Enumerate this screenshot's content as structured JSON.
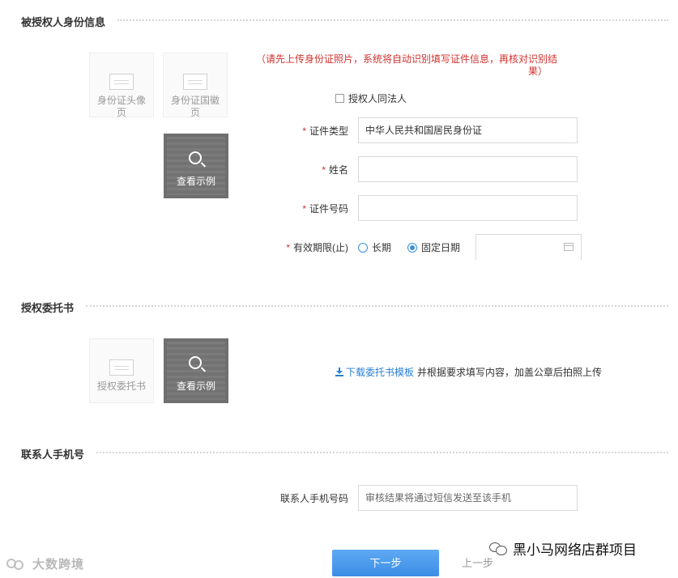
{
  "sections": {
    "authorized_person": "被授权人身份信息",
    "authorization_letter": "授权委托书",
    "contact_phone": "联系人手机号"
  },
  "uploads": {
    "id_front": "身份证头像页",
    "id_back": "身份证国徽页",
    "sample": "查看示例",
    "letter": "授权委托书"
  },
  "notice": {
    "line1": "（请先上传身份证照片，系统将自动识别填写证件信息，再核对识别结",
    "line2": "果）"
  },
  "form": {
    "same_as_legal": "授权人同法人",
    "id_type_label": "证件类型",
    "id_type_value": "中华人民共和国居民身份证",
    "name_label": "姓名",
    "name_value": "",
    "id_number_label": "证件号码",
    "id_number_value": "",
    "validity_label": "有效期限(止)",
    "validity_options": [
      "长期",
      "固定日期"
    ],
    "validity_selected": "固定日期",
    "date_value": ""
  },
  "letter": {
    "download_link": "下载委托书模板",
    "instructions": "并根据要求填写内容，加盖公章后拍照上传"
  },
  "contact": {
    "phone_label": "联系人手机号码",
    "phone_placeholder": "审核结果将通过短信发送至该手机"
  },
  "buttons": {
    "next": "下一步",
    "prev": "上一步"
  },
  "watermarks": {
    "left": "大数跨境",
    "right": "黑小马网络店群项目"
  },
  "colors": {
    "primary": "#3b8ee6",
    "required": "#d0322f",
    "link": "#2a7fd4"
  }
}
